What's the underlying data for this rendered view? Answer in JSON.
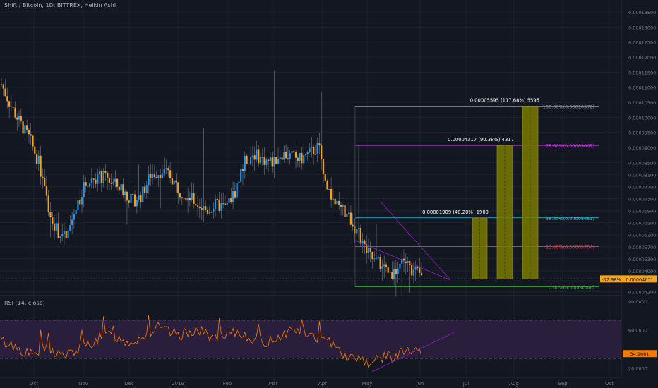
{
  "header": {
    "title": "Shift / Bitcoin, 1D, BITTREX, Heikin Ashi",
    "rsi_title": "RSI (14, close)"
  },
  "colors": {
    "background": "#131722",
    "grid": "#1e222d",
    "up": "#2196f3",
    "down": "#f7a21b",
    "wick": "#787b86",
    "axis_text": "#787b86",
    "fib_0": "#4caf50",
    "fib_236": "#f23645",
    "fib_382": "#26c6da",
    "fib_786": "#e040fb",
    "fib_100": "#9598a1",
    "box_fill": "#7a7a00",
    "wedge": "#7b1fa2",
    "rsi_line": "#f57c00",
    "rsi_band": "#2a1e3d",
    "price_tag": "#f7a21b",
    "pct_tag": "#f7a21b"
  },
  "chart_data": {
    "type": "candlestick",
    "title": "Shift / Bitcoin, 1D, BITTREX, Heikin Ashi",
    "y_axis": {
      "ylim": [
        4.1e-05,
        0.000139
      ],
      "ticks": [
        "0.00004200",
        "0.00004900",
        "0.00005300",
        "0.00005700",
        "0.00006100",
        "0.00006500",
        "0.00006900",
        "0.00007300",
        "0.00007700",
        "0.00008100",
        "0.00008500",
        "0.00009000",
        "0.00009500",
        "0.00010000",
        "0.00010500",
        "0.00011000",
        "0.00011500",
        "0.00012000",
        "0.00012500",
        "0.00013000",
        "0.00013500"
      ],
      "tick_values": [
        4.2e-05,
        4.9e-05,
        5.3e-05,
        5.7e-05,
        6.1e-05,
        6.5e-05,
        6.9e-05,
        7.3e-05,
        7.7e-05,
        8.1e-05,
        8.5e-05,
        9e-05,
        9.5e-05,
        0.0001,
        0.000105,
        0.00011,
        0.000115,
        0.00012,
        0.000125,
        0.00013,
        0.000135
      ]
    },
    "x_axis": {
      "labels": [
        "Oct",
        "Nov",
        "Dec",
        "2019",
        "Feb",
        "Mar",
        "Apr",
        "May",
        "Jun",
        "Jul",
        "Aug",
        "Sep",
        "Oct"
      ]
    },
    "price_path": [
      0.000111,
      0.000104,
      9.8e-05,
      9.3e-05,
      8.5e-05,
      7e-05,
      6.2e-05,
      6e-05,
      7e-05,
      7.8e-05,
      8e-05,
      8e-05,
      7.8e-05,
      7.6e-05,
      7.2e-05,
      7.4e-05,
      8.1e-05,
      8.2e-05,
      8.1e-05,
      7.6e-05,
      7.4e-05,
      7.1e-05,
      6.9e-05,
      7.1e-05,
      7e-05,
      7.5e-05,
      8.5e-05,
      8.8e-05,
      8.6e-05,
      8.5e-05,
      8.8e-05,
      8.7e-05,
      8.6e-05,
      8.8e-05,
      9e-05,
      7.6e-05,
      7e-05,
      6.8e-05,
      6.3e-05,
      5.6e-05,
      5.2e-05,
      5e-05,
      4.8e-05,
      5.3e-05,
      4.9e-05,
      4.7e-05
    ],
    "current_price": "0.00004631",
    "current_price_value": 4.631e-05,
    "change_pct": "-57.98%",
    "fib_levels": [
      {
        "value": 4.366e-05,
        "label": "0.00%(0.00004366)"
      },
      {
        "value": 5.704e-05,
        "label": "23.60%(0.00005704)"
      },
      {
        "value": 6.661e-05,
        "label": "38.20%(0.00006661)"
      },
      {
        "value": 9.067e-05,
        "label": "78.60%(0.00009067)"
      },
      {
        "value": 0.00010372,
        "label": "100.00%(0.00010372)"
      }
    ],
    "targets": [
      {
        "label": "0.00001909 (40.20%) 1909",
        "top": 6.661e-05
      },
      {
        "label": "0.00004317 (90.38%) 4317",
        "top": 9.067e-05
      },
      {
        "label": "0.00005595 (117.68%) 5595",
        "top": 0.00010372
      }
    ],
    "rsi": {
      "ylim": [
        10,
        95
      ],
      "ticks": [
        "90.0000",
        "60.0000",
        "20.0000"
      ],
      "tick_values": [
        90,
        60,
        20
      ],
      "upper_band": 70,
      "lower_band": 30,
      "current": "34.9661",
      "current_value": 34.9661,
      "path": [
        48,
        45,
        42,
        38,
        34,
        36,
        40,
        38,
        35,
        33,
        36,
        40,
        44,
        48,
        52,
        55,
        52,
        49,
        47,
        50,
        54,
        58,
        62,
        59,
        56,
        54,
        57,
        60,
        58,
        55,
        52,
        50,
        54,
        57,
        55,
        52,
        48,
        46,
        50,
        53,
        57,
        61,
        58,
        55,
        52,
        49,
        46,
        48,
        34,
        30,
        32,
        28,
        24,
        30,
        33,
        31,
        35,
        38,
        36,
        35
      ]
    }
  }
}
